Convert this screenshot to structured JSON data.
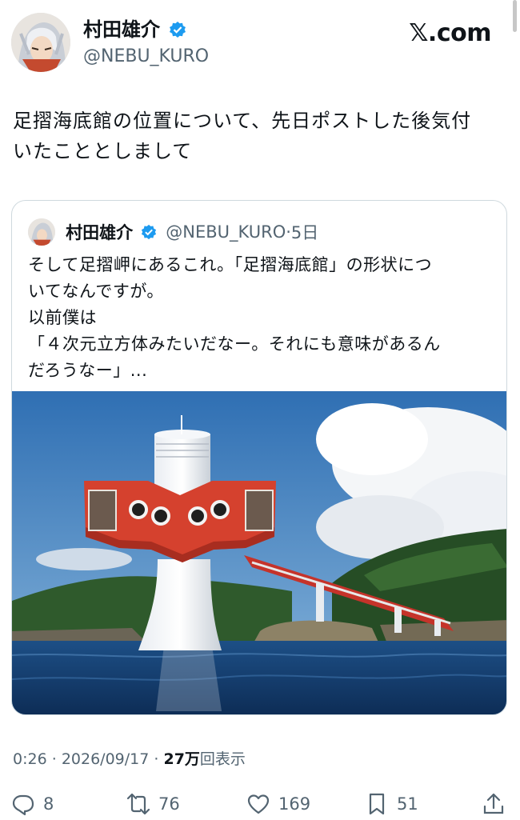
{
  "author": {
    "display_name": "村田雄介",
    "handle": "@NEBU_KURO",
    "verified_color": "#1d9bf0"
  },
  "brand": {
    "logo_text": "𝕏.com"
  },
  "post": {
    "text_lines": [
      "足摺海底館の位置について、先日ポストした後気付",
      "いたこととしまして"
    ]
  },
  "quote": {
    "display_name": "村田雄介",
    "handle": "@NEBU_KURO",
    "separator": "·",
    "time": "5日",
    "text_lines": [
      "そして足摺岬にあるこれ。「足摺海底館」の形状につ",
      "いてなんですが。",
      "以前僕は",
      "「４次元立方体みたいだなー。それにも意味があるん",
      "だろうなー」..."
    ],
    "image": {
      "subject": "red underwater observatory tower in the sea"
    }
  },
  "meta": {
    "time": "0:26",
    "sep": "·",
    "date": "2026/09/17",
    "sep2": "·",
    "views": "27万",
    "views_suffix": "回表示"
  },
  "actions": {
    "replies": "8",
    "reposts": "76",
    "likes": "169",
    "bookmarks": "51"
  },
  "colors": {
    "text": "#0f1419",
    "muted": "#536471",
    "accent": "#1d9bf0",
    "border": "#cfd9de"
  }
}
